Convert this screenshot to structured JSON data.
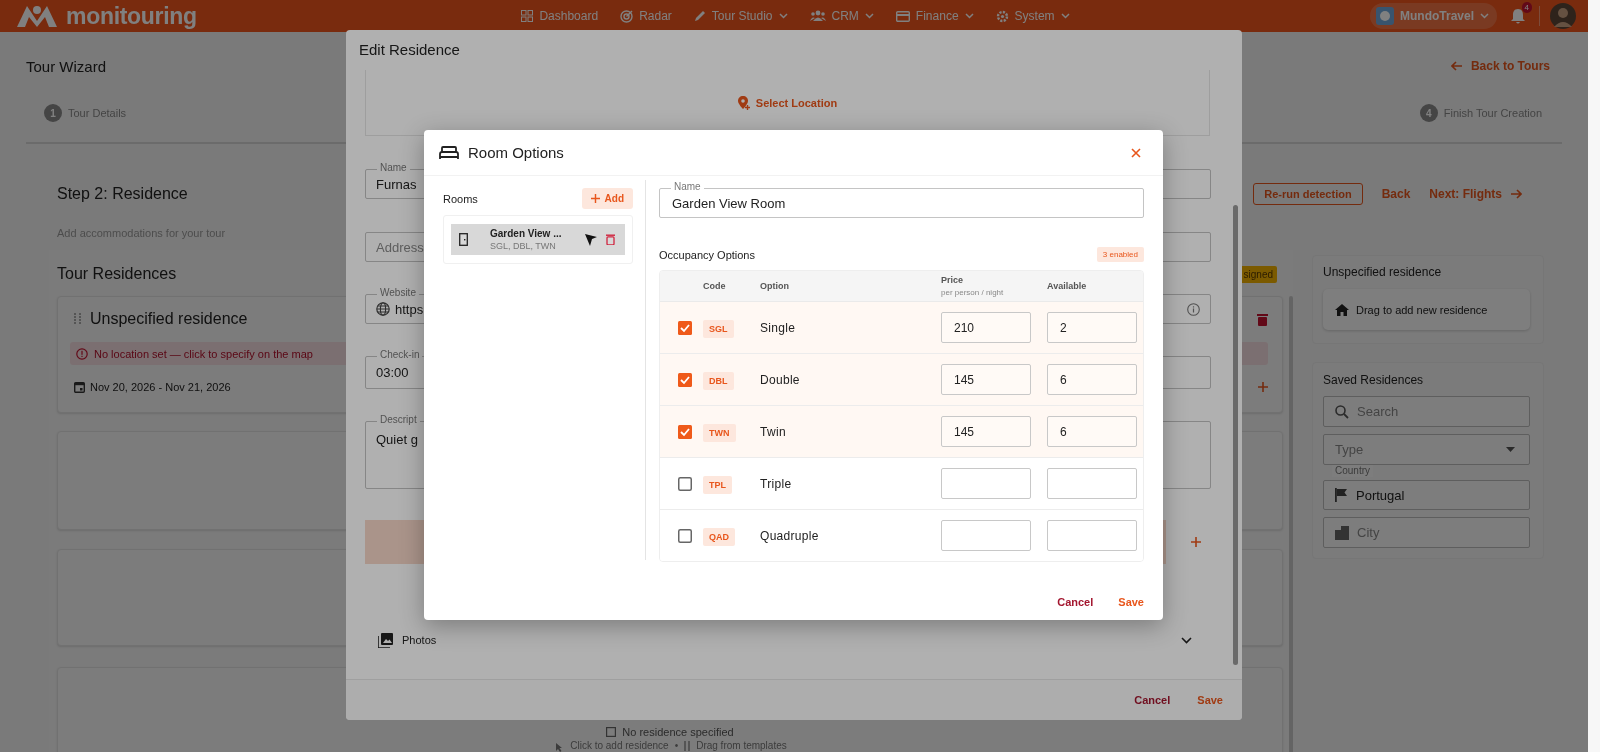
{
  "top_nav": {
    "logo": "monitouring",
    "items": [
      {
        "label": "Dashboard",
        "dropdown": false
      },
      {
        "label": "Radar",
        "dropdown": false
      },
      {
        "label": "Tour Studio",
        "dropdown": true
      },
      {
        "label": "CRM",
        "dropdown": true
      },
      {
        "label": "Finance",
        "dropdown": true
      },
      {
        "label": "System",
        "dropdown": true
      }
    ],
    "account": "MundoTravel",
    "notifications": "4"
  },
  "page": {
    "title": "Tour Wizard",
    "back_link": "Back to Tours",
    "steps": [
      {
        "number": "1",
        "label": "Tour Details"
      },
      {
        "number": "4",
        "label": "Finish Tour Creation"
      }
    ],
    "step_title": "Step 2: Residence",
    "step_subtitle": "Add accommodations for your tour",
    "actions": [
      {
        "label": "Re-run detection",
        "kind": "outlined"
      },
      {
        "label": "Back",
        "kind": "text"
      },
      {
        "label": "Next: Flights",
        "kind": "forward"
      }
    ],
    "residences": {
      "title": "Tour Residences",
      "badge": "signed",
      "cards": [
        {
          "kind": "residence",
          "name": "Unspecified residence",
          "alert": "No location set — click to specify on the map",
          "dates": "Nov 20, 2026 - Nov 21, 2026"
        },
        {
          "kind": "blank"
        },
        {
          "kind": "blank"
        },
        {
          "kind": "empty",
          "message": "No residence specified",
          "hint_click": "Click to add residence",
          "separator": "•",
          "hint_drag": "Drag from templates"
        }
      ]
    },
    "sidebar": {
      "unspecified_title": "Unspecified residence",
      "drag_hint": "Drag to add new residence",
      "saved_title": "Saved Residences",
      "search_placeholder": "Search",
      "type_placeholder": "Type",
      "country_label": "Country",
      "country_value": "Portugal",
      "city_placeholder": "City"
    }
  },
  "edit_dialog": {
    "title": "Edit Residence",
    "select_location": "Select Location",
    "name_label": "Name",
    "name_value": "Furnas",
    "address_placeholder": "Address",
    "website_label": "Website",
    "website_value": "https",
    "checkin_label": "Check-in",
    "checkin_value": "03:00",
    "description_label": "Descript",
    "description_value": "Quiet g",
    "photos": "Photos",
    "photos_expanded": false,
    "buttons": [
      "Cancel",
      "Save"
    ]
  },
  "room_dialog": {
    "title": "Room Options",
    "rooms_title": "Rooms",
    "add_button": "Add",
    "rooms": [
      {
        "name": "Garden View ...",
        "codes": "SGL, DBL, TWN",
        "selected": true
      }
    ],
    "name_label": "Name",
    "name_value": "Garden View Room",
    "occupancy_title": "Occupancy Options",
    "enabled_badge": "3 enabled",
    "columns": {
      "code": "Code",
      "option": "Option",
      "price": "Price",
      "price_note": "per person / night",
      "available": "Available"
    },
    "rows": [
      {
        "code": "SGL",
        "option": "Single",
        "enabled": true,
        "price": "210",
        "available": "2"
      },
      {
        "code": "DBL",
        "option": "Double",
        "enabled": true,
        "price": "145",
        "available": "6"
      },
      {
        "code": "TWN",
        "option": "Twin",
        "enabled": true,
        "price": "145",
        "available": "6"
      },
      {
        "code": "TPL",
        "option": "Triple",
        "enabled": false
      },
      {
        "code": "QAD",
        "option": "Quadruple",
        "enabled": false
      }
    ],
    "buttons": [
      "Cancel",
      "Save"
    ]
  }
}
